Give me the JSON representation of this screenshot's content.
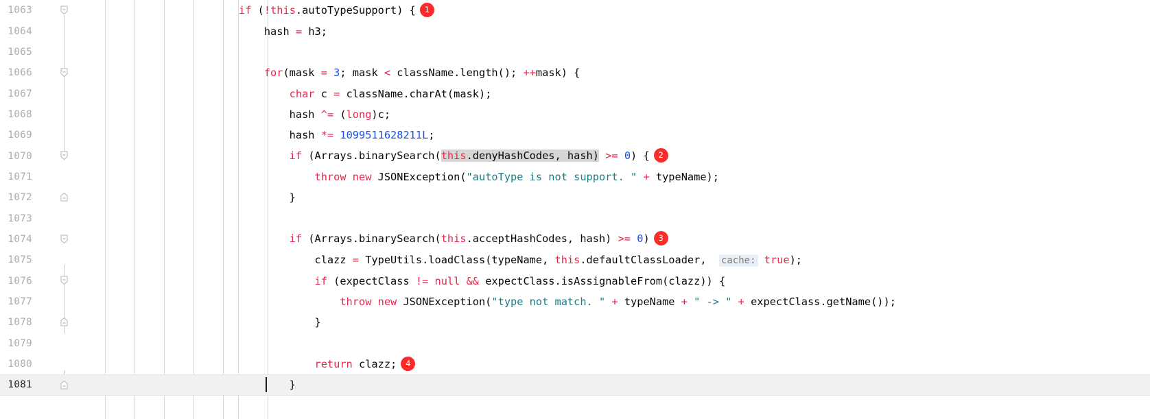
{
  "editor": {
    "language": "java",
    "theme": "light",
    "colors": {
      "background": "#ffffff",
      "keyword": "#e8274b",
      "number": "#1750eb",
      "string": "#1d7b87",
      "plain_text": "#080808",
      "line_number": "#adadad",
      "line_number_current": "#252525",
      "current_line_bg": "#f1f1f1",
      "selection_bg": "#d6d6d6",
      "indent_guide": "#d8d8dc",
      "badge_bg": "#fa2b2b",
      "badge_text": "#ffffff",
      "param_hint_bg": "#e8eff7",
      "param_hint_text": "#7a7a7a"
    },
    "current_line": 1081,
    "caret": {
      "line": 1081,
      "column": 9
    },
    "first_visible_line": 1063,
    "last_visible_line": 1081
  },
  "badges": [
    {
      "number": "1",
      "line": 1063
    },
    {
      "number": "2",
      "line": 1070
    },
    {
      "number": "3",
      "line": 1074
    },
    {
      "number": "4",
      "line": 1080
    }
  ],
  "selection": {
    "line": 1070,
    "text": "this.denyHashCodes, hash)"
  },
  "parameter_hint": {
    "line": 1075,
    "label": "cache:"
  },
  "lines": [
    {
      "number": "1063",
      "fold": "collapse",
      "tokens": [
        {
          "t": "kw",
          "s": "if"
        },
        {
          "t": "plain",
          "s": " ("
        },
        {
          "t": "op",
          "s": "!"
        },
        {
          "t": "kw",
          "s": "this"
        },
        {
          "t": "plain",
          "s": ".autoTypeSupport) {"
        }
      ],
      "badge": "1"
    },
    {
      "number": "1064",
      "fold": null,
      "tokens": [
        {
          "t": "plain",
          "s": "    hash "
        },
        {
          "t": "op",
          "s": "="
        },
        {
          "t": "plain",
          "s": " h3;"
        }
      ],
      "badge": null
    },
    {
      "number": "1065",
      "fold": null,
      "tokens": [],
      "badge": null
    },
    {
      "number": "1066",
      "fold": "collapse",
      "tokens": [
        {
          "t": "kw",
          "s": "    for"
        },
        {
          "t": "plain",
          "s": "(mask "
        },
        {
          "t": "op",
          "s": "="
        },
        {
          "t": "plain",
          "s": " "
        },
        {
          "t": "num",
          "s": "3"
        },
        {
          "t": "plain",
          "s": "; mask "
        },
        {
          "t": "op",
          "s": "<"
        },
        {
          "t": "plain",
          "s": " className.length(); "
        },
        {
          "t": "op",
          "s": "++"
        },
        {
          "t": "plain",
          "s": "mask) {"
        }
      ],
      "badge": null
    },
    {
      "number": "1067",
      "fold": null,
      "tokens": [
        {
          "t": "kw",
          "s": "        char"
        },
        {
          "t": "plain",
          "s": " c "
        },
        {
          "t": "op",
          "s": "="
        },
        {
          "t": "plain",
          "s": " className.charAt(mask);"
        }
      ],
      "badge": null
    },
    {
      "number": "1068",
      "fold": null,
      "tokens": [
        {
          "t": "plain",
          "s": "        hash "
        },
        {
          "t": "op",
          "s": "^="
        },
        {
          "t": "plain",
          "s": " ("
        },
        {
          "t": "kw",
          "s": "long"
        },
        {
          "t": "plain",
          "s": ")c;"
        }
      ],
      "badge": null
    },
    {
      "number": "1069",
      "fold": null,
      "tokens": [
        {
          "t": "plain",
          "s": "        hash "
        },
        {
          "t": "op",
          "s": "*="
        },
        {
          "t": "plain",
          "s": " "
        },
        {
          "t": "num",
          "s": "1099511628211L"
        },
        {
          "t": "plain",
          "s": ";"
        }
      ],
      "badge": null
    },
    {
      "number": "1070",
      "fold": "collapse",
      "tokens": [
        {
          "t": "kw",
          "s": "        if"
        },
        {
          "t": "plain",
          "s": " (Arrays.binarySearch("
        },
        {
          "t": "kw",
          "s": "this",
          "sel": true
        },
        {
          "t": "plain",
          "s": ".denyHashCodes, hash)",
          "sel": true
        },
        {
          "t": "plain",
          "s": " "
        },
        {
          "t": "op",
          "s": ">="
        },
        {
          "t": "plain",
          "s": " "
        },
        {
          "t": "num",
          "s": "0"
        },
        {
          "t": "plain",
          "s": ") {"
        }
      ],
      "badge": "2"
    },
    {
      "number": "1071",
      "fold": null,
      "tokens": [
        {
          "t": "kw",
          "s": "            throw new"
        },
        {
          "t": "plain",
          "s": " JSONException("
        },
        {
          "t": "str",
          "s": "\"autoType is not support. \""
        },
        {
          "t": "plain",
          "s": " "
        },
        {
          "t": "op",
          "s": "+"
        },
        {
          "t": "plain",
          "s": " typeName);"
        }
      ],
      "badge": null
    },
    {
      "number": "1072",
      "fold": "expand",
      "tokens": [
        {
          "t": "plain",
          "s": "        }"
        }
      ],
      "badge": null
    },
    {
      "number": "1073",
      "fold": null,
      "tokens": [],
      "badge": null
    },
    {
      "number": "1074",
      "fold": "collapse",
      "tokens": [
        {
          "t": "kw",
          "s": "        if"
        },
        {
          "t": "plain",
          "s": " (Arrays.binarySearch("
        },
        {
          "t": "kw",
          "s": "this"
        },
        {
          "t": "plain",
          "s": ".acceptHashCodes, hash) "
        },
        {
          "t": "op",
          "s": ">="
        },
        {
          "t": "plain",
          "s": " "
        },
        {
          "t": "num",
          "s": "0"
        },
        {
          "t": "plain",
          "s": ")"
        }
      ],
      "badge": "3"
    },
    {
      "number": "1075",
      "fold": null,
      "tokens": [
        {
          "t": "plain",
          "s": "            clazz "
        },
        {
          "t": "op",
          "s": "="
        },
        {
          "t": "plain",
          "s": " TypeUtils.loadClass(typeName, "
        },
        {
          "t": "kw",
          "s": "this"
        },
        {
          "t": "plain",
          "s": ".defaultClassLoader,  "
        },
        {
          "t": "hint",
          "s": "cache:"
        },
        {
          "t": "plain",
          "s": " "
        },
        {
          "t": "kw",
          "s": "true"
        },
        {
          "t": "plain",
          "s": ");"
        }
      ],
      "badge": null
    },
    {
      "number": "1076",
      "fold": "collapse",
      "tokens": [
        {
          "t": "kw",
          "s": "            if"
        },
        {
          "t": "plain",
          "s": " (expectClass "
        },
        {
          "t": "op",
          "s": "!="
        },
        {
          "t": "plain",
          "s": " "
        },
        {
          "t": "kw",
          "s": "null"
        },
        {
          "t": "plain",
          "s": " "
        },
        {
          "t": "op",
          "s": "&&"
        },
        {
          "t": "plain",
          "s": " expectClass.isAssignableFrom(clazz)) {"
        }
      ],
      "badge": null
    },
    {
      "number": "1077",
      "fold": null,
      "tokens": [
        {
          "t": "kw",
          "s": "                throw new"
        },
        {
          "t": "plain",
          "s": " JSONException("
        },
        {
          "t": "str",
          "s": "\"type not match. \""
        },
        {
          "t": "plain",
          "s": " "
        },
        {
          "t": "op",
          "s": "+"
        },
        {
          "t": "plain",
          "s": " typeName "
        },
        {
          "t": "op",
          "s": "+"
        },
        {
          "t": "plain",
          "s": " "
        },
        {
          "t": "str",
          "s": "\" -> \""
        },
        {
          "t": "plain",
          "s": " "
        },
        {
          "t": "op",
          "s": "+"
        },
        {
          "t": "plain",
          "s": " expectClass.getName());"
        }
      ],
      "badge": null
    },
    {
      "number": "1078",
      "fold": "expand",
      "tokens": [
        {
          "t": "plain",
          "s": "            }"
        }
      ],
      "badge": null
    },
    {
      "number": "1079",
      "fold": null,
      "tokens": [],
      "badge": null
    },
    {
      "number": "1080",
      "fold": null,
      "tokens": [
        {
          "t": "kw",
          "s": "            return"
        },
        {
          "t": "plain",
          "s": " clazz;"
        }
      ],
      "badge": "4"
    },
    {
      "number": "1081",
      "fold": "expand",
      "current": true,
      "tokens": [
        {
          "t": "plain",
          "s": "        }"
        }
      ],
      "badge": null
    }
  ]
}
